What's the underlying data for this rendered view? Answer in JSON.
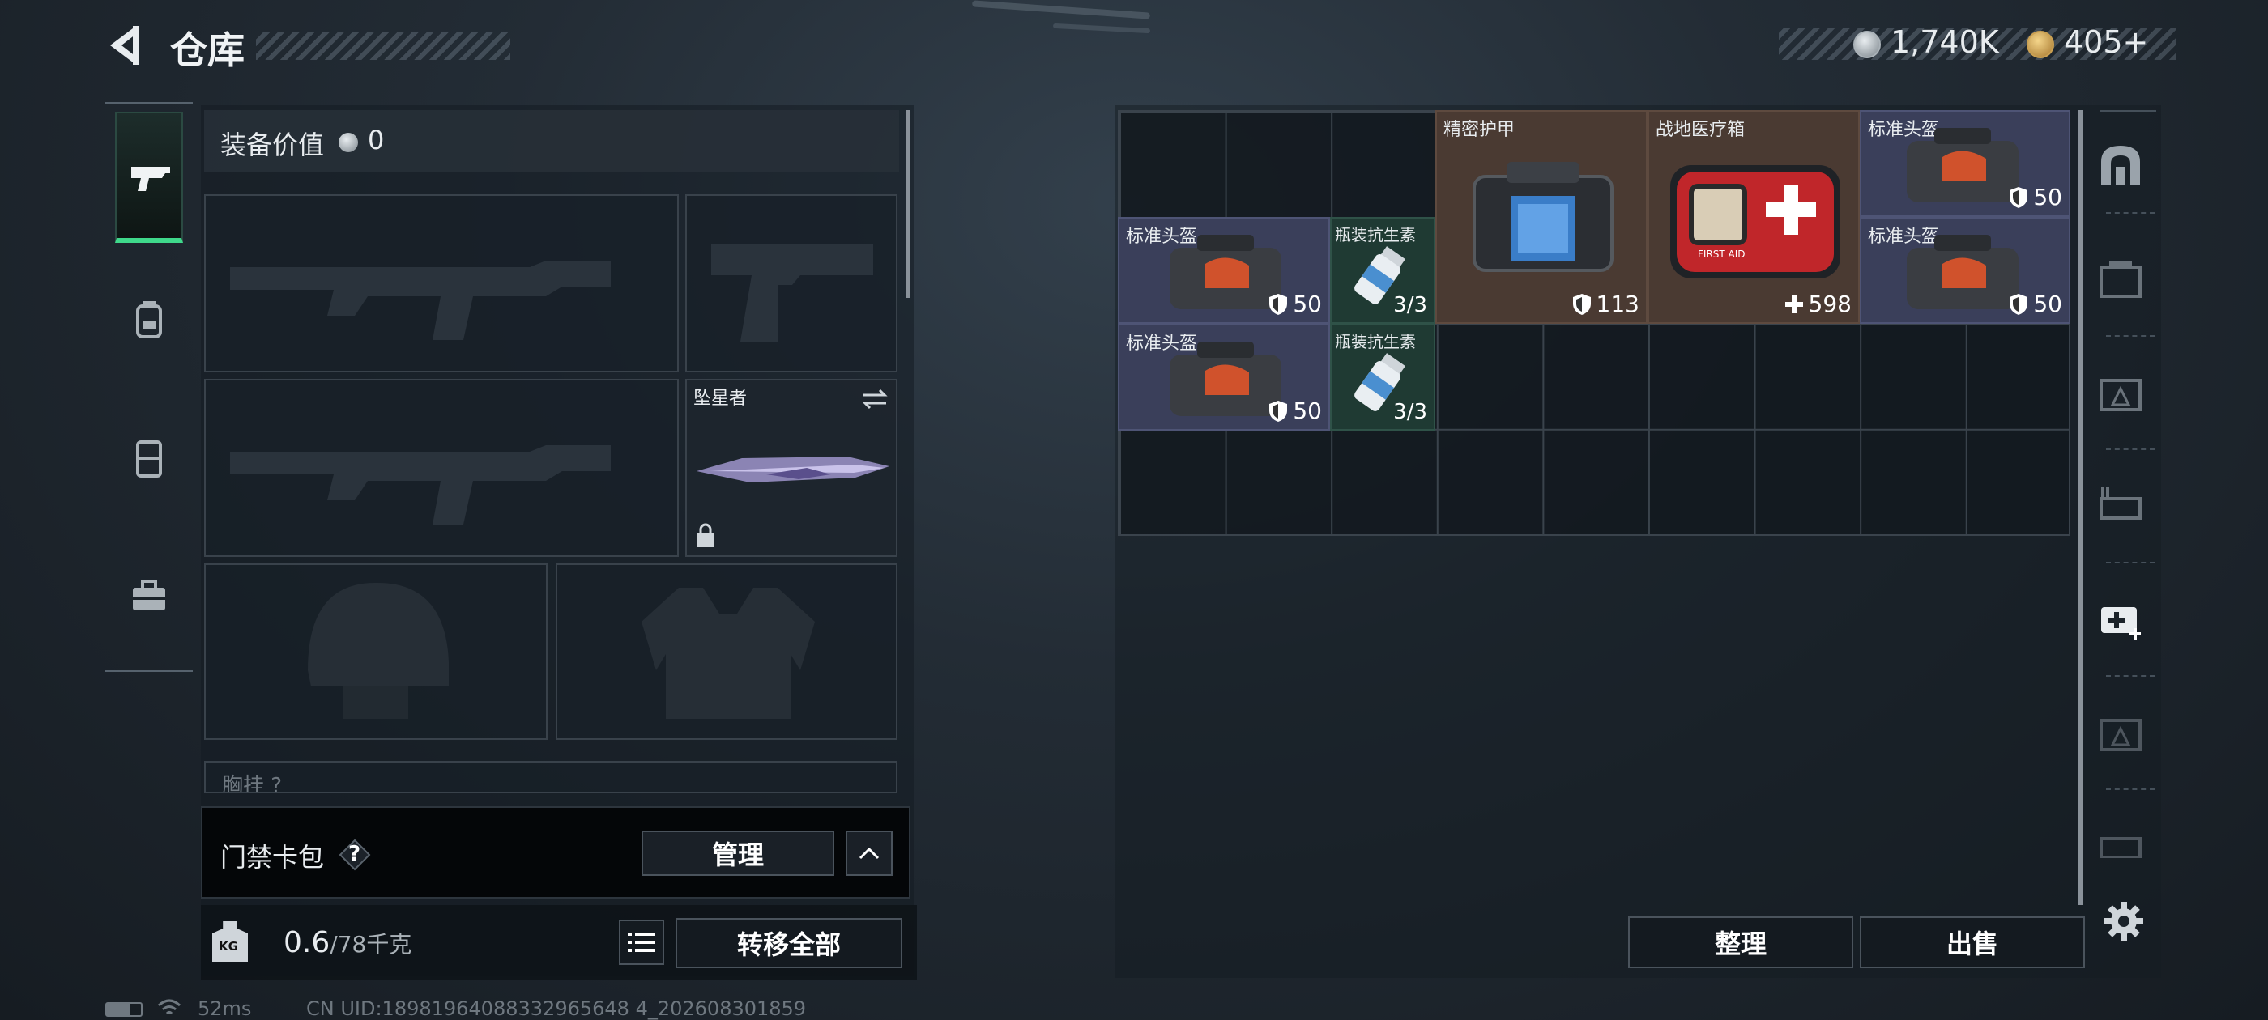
{
  "header": {
    "title": "仓库",
    "currency1": "1,740K",
    "currency2": "405",
    "currency2_plus": "+"
  },
  "loadout": {
    "value_label": "装备价值",
    "value": "0",
    "melee_name": "坠星者",
    "rig_label": "胸挂",
    "rig_hint": "?"
  },
  "keycard": {
    "label": "门禁卡包",
    "help": "?",
    "manage": "管理"
  },
  "weight": {
    "current": "0.6",
    "max": "/78千克",
    "kg_icon": "KG",
    "transfer_all": "转移全部"
  },
  "stash": {
    "items": [
      {
        "name": "精密护甲",
        "value": "113",
        "stat": "shield"
      },
      {
        "name": "战地医疗箱",
        "value": "598",
        "stat": "plus"
      },
      {
        "name": "标准头盔",
        "value": "50",
        "stat": "shield"
      },
      {
        "name": "标准头盔",
        "value": "50",
        "stat": "shield"
      },
      {
        "name": "瓶装抗生素",
        "value": "3/3"
      },
      {
        "name": "标准头盔",
        "value": "50",
        "stat": "shield"
      },
      {
        "name": "标准头盔",
        "value": "50",
        "stat": "shield"
      },
      {
        "name": "瓶装抗生素",
        "value": "3/3"
      }
    ],
    "sort_label": "整理",
    "sell_label": "出售"
  },
  "status": {
    "ping": "52ms",
    "uid": "CN UID:18981964088332965648 4_202608301859"
  },
  "colors": {
    "accent_green": "#3fd98b",
    "rarity_purple": "#3a3f5a",
    "rarity_brown": "#4a3a32",
    "rarity_green": "#1f3a33"
  },
  "icons": [
    "back-arrow-icon",
    "pistol-icon",
    "backpack-icon",
    "vest-icon",
    "briefcase-icon",
    "settings-icon",
    "medkit-icon"
  ]
}
